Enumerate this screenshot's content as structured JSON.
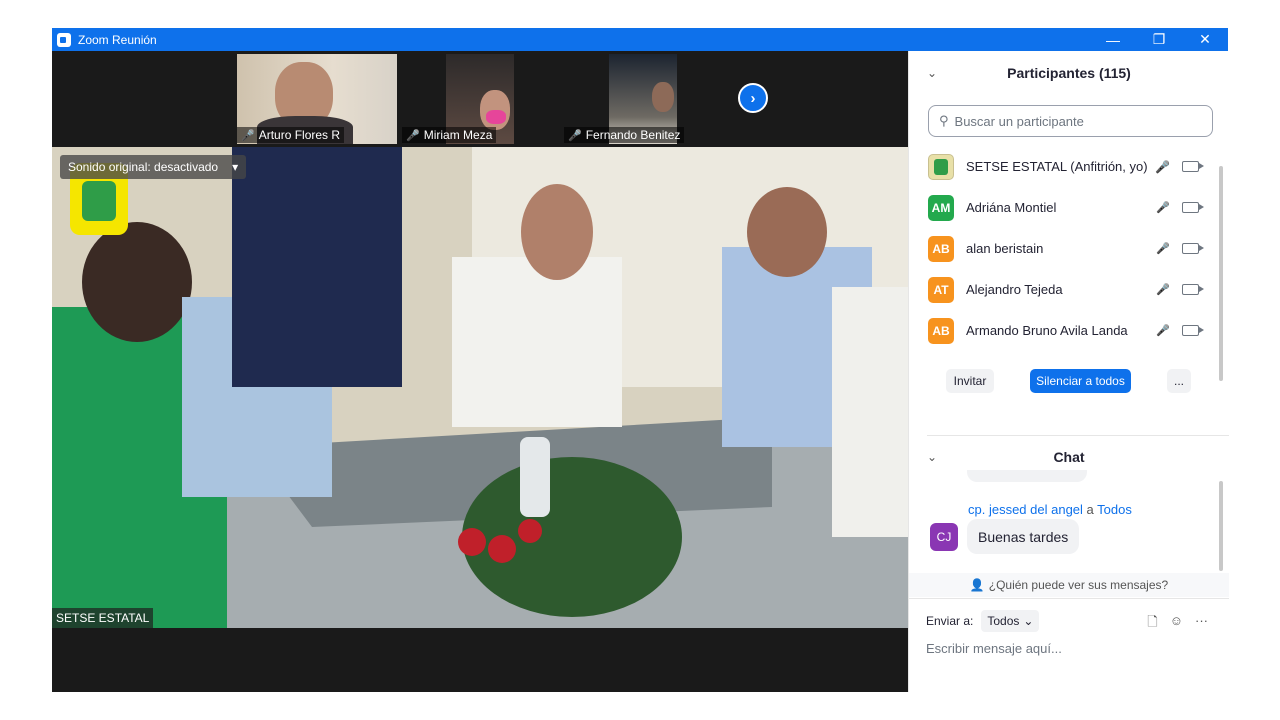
{
  "window": {
    "title": "Zoom Reunión"
  },
  "thumbnails": [
    {
      "name": "Arturo Flores R"
    },
    {
      "name": "Miriam Meza"
    },
    {
      "name": "Fernando Benitez"
    }
  ],
  "main_video": {
    "sound_pill": "Sonido original: desactivado",
    "speaker": "SETSE ESTATAL"
  },
  "participants": {
    "header": "Participantes (115)",
    "search_placeholder": "Buscar un participante",
    "list": [
      {
        "initials": "",
        "name": "SETSE ESTATAL (Anfitrión, yo)",
        "color": "#e8e0a8"
      },
      {
        "initials": "AM",
        "name": "Adriána Montiel",
        "color": "#23a94d"
      },
      {
        "initials": "AB",
        "name": "alan beristain",
        "color": "#f7931e"
      },
      {
        "initials": "AT",
        "name": "Alejandro Tejeda",
        "color": "#f7931e"
      },
      {
        "initials": "AB",
        "name": "Armando Bruno Avila Landa",
        "color": "#f7931e"
      }
    ],
    "invite": "Invitar",
    "mute_all": "Silenciar a todos",
    "more": "..."
  },
  "chat": {
    "header": "Chat",
    "message": {
      "sender": "cp. jessed  del angel",
      "to_word": "a",
      "recipient": "Todos",
      "avatar": "CJ",
      "text": "Buenas tardes"
    },
    "who_sees": "¿Quién puede ver sus mensajes?",
    "send_to_label": "Enviar a:",
    "send_to_value": "Todos",
    "compose_placeholder": "Escribir mensaje aquí..."
  }
}
